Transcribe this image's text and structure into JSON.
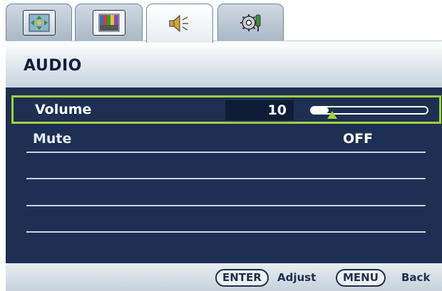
{
  "tabs": [
    {
      "icon": "display-adjust-icon",
      "active": false
    },
    {
      "icon": "picture-color-icon",
      "active": false
    },
    {
      "icon": "speaker-volume-icon",
      "active": true
    },
    {
      "icon": "system-settings-icon",
      "active": false
    }
  ],
  "title": "AUDIO",
  "menu": {
    "volume": {
      "label": "Volume",
      "value": "10",
      "level": 0.1
    },
    "mute": {
      "label": "Mute",
      "value": "OFF"
    }
  },
  "footer": {
    "enter_key": "ENTER",
    "enter_action": "Adjust",
    "menu_key": "MENU",
    "menu_action": "Back"
  },
  "colors": {
    "panel": "#1d3053",
    "highlight": "#9fd23a",
    "title_text": "#0e1f3a"
  }
}
